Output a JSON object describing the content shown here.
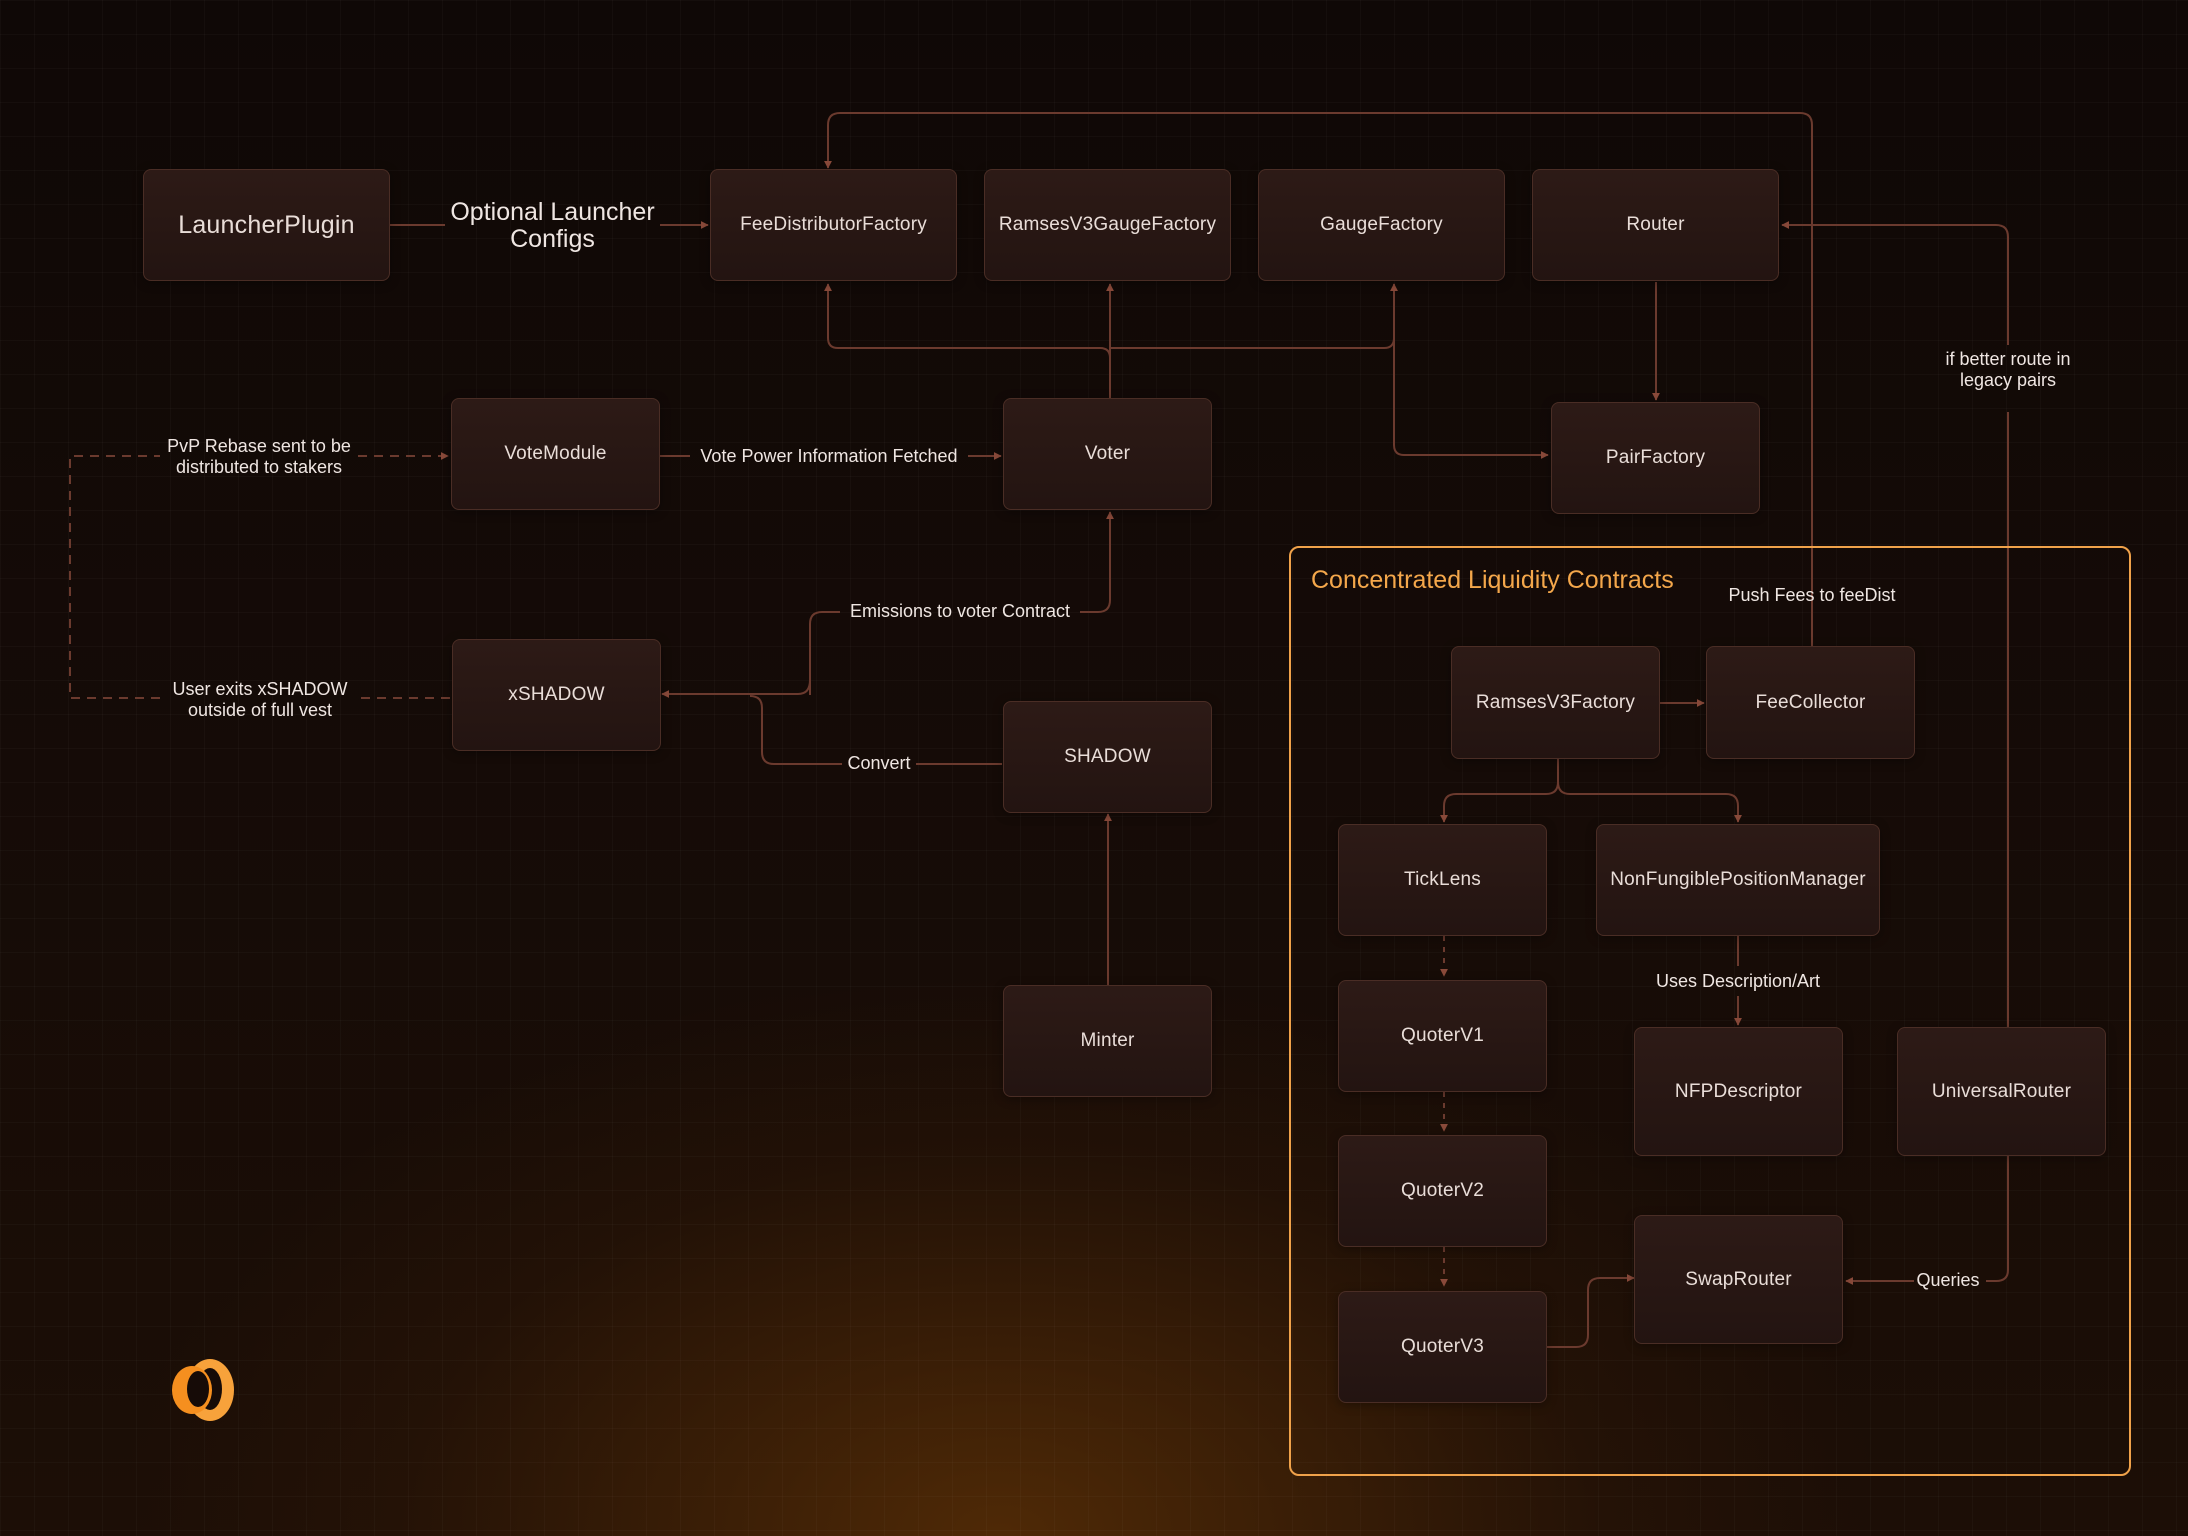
{
  "diagram": {
    "group_title": "Concentrated Liquidity Contracts",
    "nodes": {
      "launcher_plugin": "LauncherPlugin",
      "fee_distributor_factory": "FeeDistributorFactory",
      "ramses_v3_gauge_factory": "RamsesV3GaugeFactory",
      "gauge_factory": "GaugeFactory",
      "router": "Router",
      "vote_module": "VoteModule",
      "voter": "Voter",
      "pair_factory": "PairFactory",
      "xshadow": "xSHADOW",
      "shadow": "SHADOW",
      "minter": "Minter",
      "ramses_v3_factory": "RamsesV3Factory",
      "fee_collector": "FeeCollector",
      "tick_lens": "TickLens",
      "nonfungible_position_manager": "NonFungiblePositionManager",
      "quoter_v1": "QuoterV1",
      "nfp_descriptor": "NFPDescriptor",
      "universal_router": "UniversalRouter",
      "quoter_v2": "QuoterV2",
      "swap_router": "SwapRouter",
      "quoter_v3": "QuoterV3"
    },
    "edges": {
      "optional_launcher_configs": "Optional Launcher Configs",
      "pvp_rebase": "PvP Rebase sent to be distributed to stakers",
      "vote_power": "Vote Power Information Fetched",
      "if_better_route": "if better route in legacy pairs",
      "emissions": "Emissions to voter Contract",
      "push_fees": "Push Fees to feeDist",
      "user_exits": "User exits xSHADOW outside of full vest",
      "convert": "Convert",
      "uses_description": "Uses Description/Art",
      "queries": "Queries"
    }
  },
  "colors": {
    "accent": "#f0a24a",
    "line": "#6b3a2e",
    "node_fill": "#2a1814",
    "node_border": "#4a2d25"
  },
  "logo_icon": "shadow-logo-icon"
}
